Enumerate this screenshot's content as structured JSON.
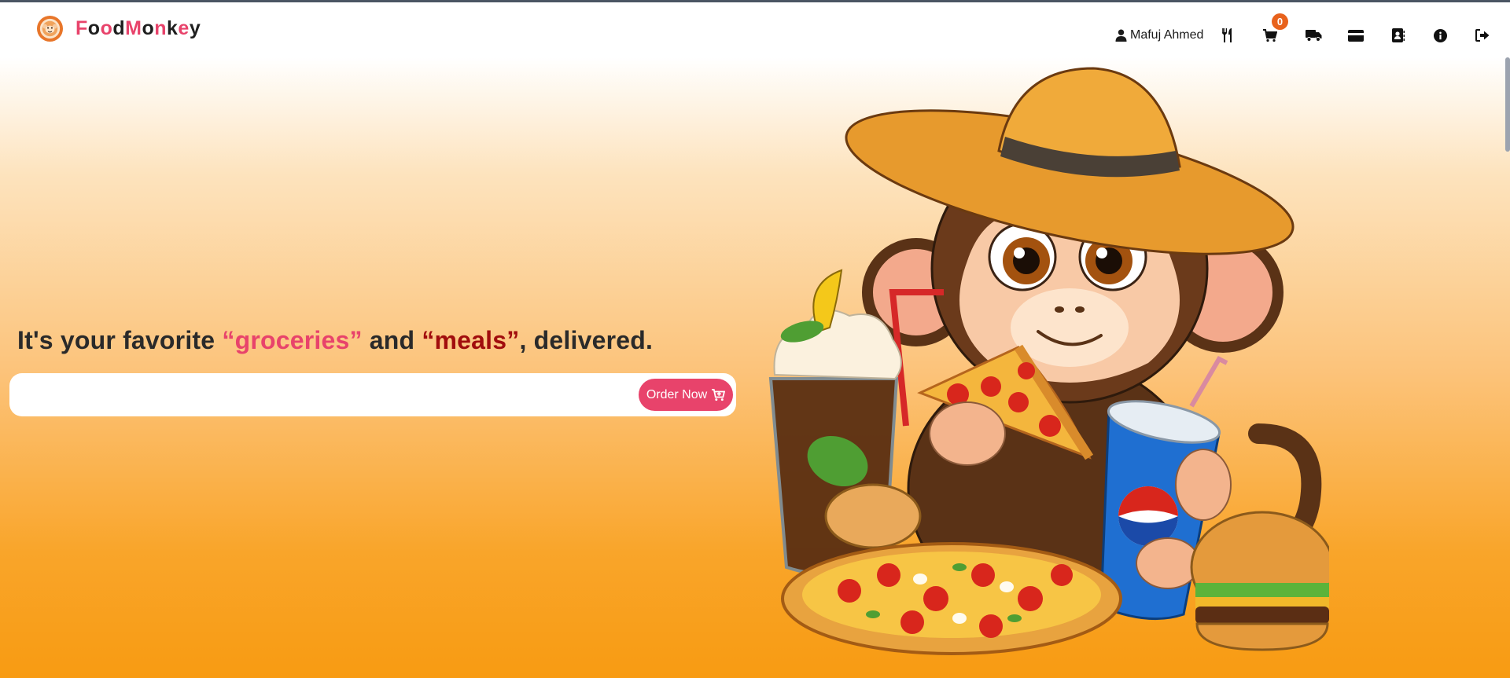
{
  "brand": {
    "letters": [
      {
        "ch": "F",
        "color": "#e8436b"
      },
      {
        "ch": "o",
        "color": "#1f1f1f"
      },
      {
        "ch": "o",
        "color": "#e8436b"
      },
      {
        "ch": "d",
        "color": "#1f1f1f"
      },
      {
        "ch": "M",
        "color": "#e8436b"
      },
      {
        "ch": "o",
        "color": "#1f1f1f"
      },
      {
        "ch": "n",
        "color": "#e8436b"
      },
      {
        "ch": "k",
        "color": "#1f1f1f"
      },
      {
        "ch": "e",
        "color": "#e8436b"
      },
      {
        "ch": "y",
        "color": "#1f1f1f"
      }
    ],
    "logo_icon": "monkey-logo-icon"
  },
  "nav": {
    "user_name": "Mafuj Ahmed",
    "user_icon": "user-icon",
    "icons": [
      "utensils-icon",
      "cart-icon",
      "truck-icon",
      "credit-card-icon",
      "contact-book-icon",
      "info-icon",
      "sign-out-icon"
    ],
    "cart_count": "0"
  },
  "hero": {
    "headline_pre": "It's your favorite ",
    "highlight_1": "“groceries”",
    "headline_mid": " and ",
    "highlight_2": "“meals”",
    "headline_post": ", delivered.",
    "search_placeholder": "",
    "order_button": "Order Now",
    "order_icon": "cart-plus-icon",
    "illustration": "monkey-eating-pizza-illustration"
  },
  "colors": {
    "accent": "#e8436b",
    "dark_red": "#a10d0d",
    "badge": "#e8621c",
    "orange": "#f89b12"
  }
}
